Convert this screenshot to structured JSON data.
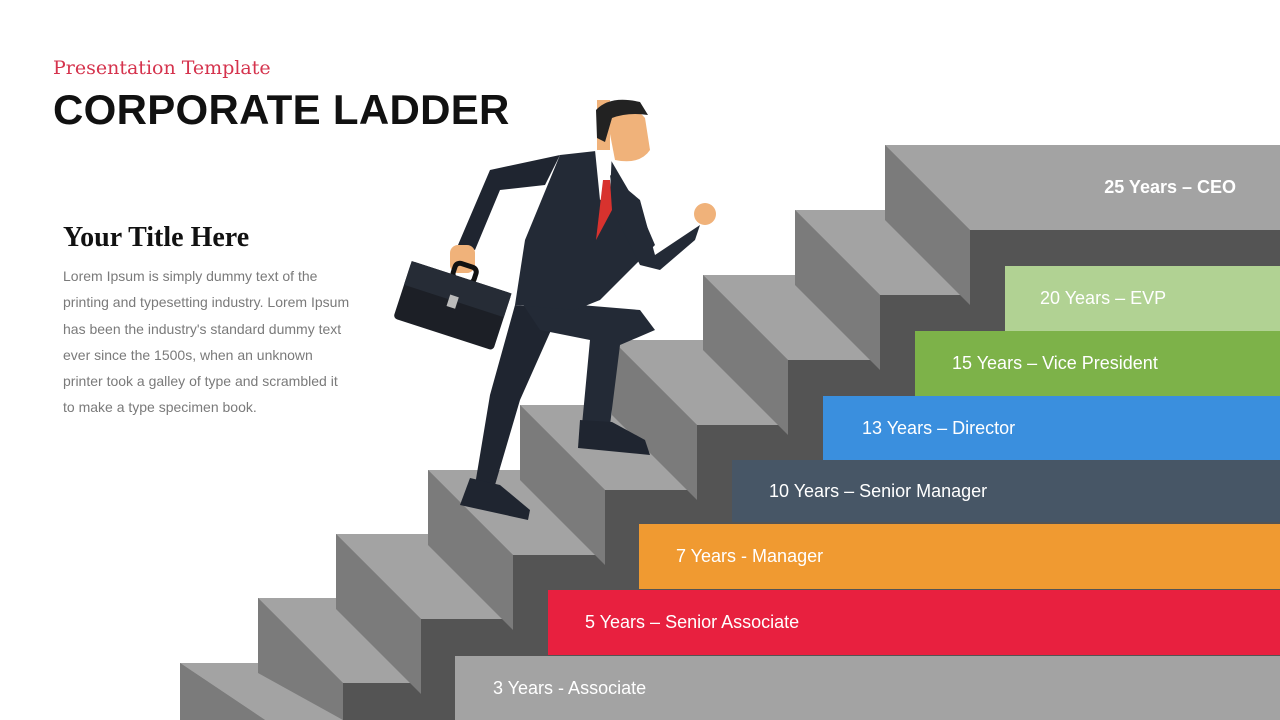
{
  "header": {
    "subtitle": "Presentation Template",
    "title": "CORPORATE LADDER"
  },
  "content": {
    "heading": "Your Title Here",
    "body": "Lorem Ipsum is simply dummy text of the printing and typesetting industry. Lorem Ipsum has been the industry's standard dummy text ever since the 1500s, when an unknown printer took a galley of type and scrambled it to make a type specimen book."
  },
  "ladder": {
    "levels": [
      {
        "label": "25 Years – CEO",
        "color": "#a3a3a3"
      },
      {
        "label": "20 Years – EVP",
        "color": "#b1d293"
      },
      {
        "label": "15 Years – Vice President",
        "color": "#7db249"
      },
      {
        "label": "13 Years – Director",
        "color": "#3a8fde"
      },
      {
        "label": "10 Years – Senior Manager",
        "color": "#475666"
      },
      {
        "label": "7 Years - Manager",
        "color": "#f09a31"
      },
      {
        "label": "5 Years – Senior Associate",
        "color": "#e8203f"
      },
      {
        "label": "3 Years - Associate",
        "color": "#a3a3a3"
      }
    ]
  },
  "illustration": {
    "icon": "businessman-climbing-stairs-icon",
    "suit_color": "#1f2530",
    "tie_color": "#d8322e",
    "skin_color": "#f0b27a"
  }
}
